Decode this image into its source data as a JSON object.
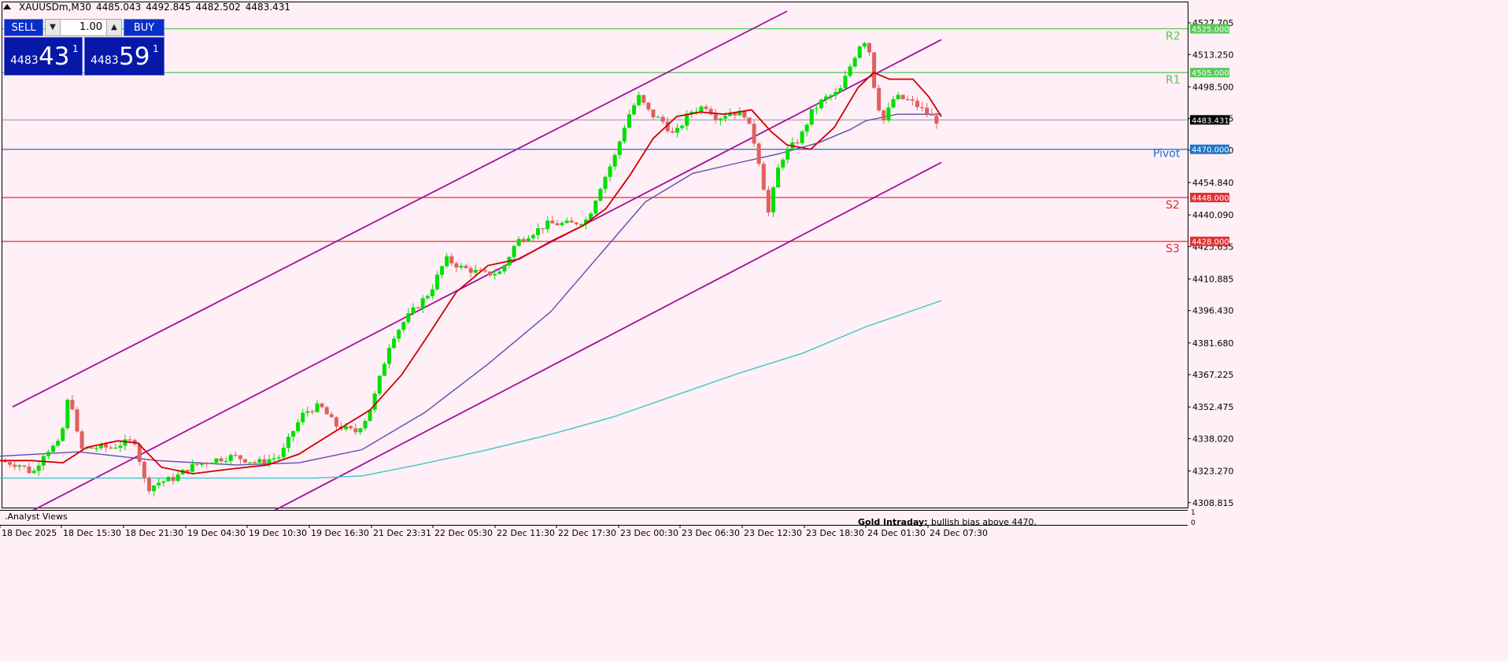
{
  "header": {
    "symbol": "XAUUSDm,M30",
    "open": "4485.043",
    "high": "4492.845",
    "low": "4482.502",
    "close": "4483.431"
  },
  "trade_panel": {
    "sell_label": "SELL",
    "buy_label": "BUY",
    "lot": "1.00",
    "bid_small": "4483",
    "bid_big": "43",
    "bid_sup": "1",
    "ask_small": "4483",
    "ask_big": "59",
    "ask_sup": "1"
  },
  "colors": {
    "background": "#ffeff6",
    "bull": "#00e000",
    "bear": "#e06060",
    "ma_fast": "#cc0000",
    "ma_mid": "#5b4fa8",
    "ma_slow": "#3cc8c8",
    "channel": "#a0119c",
    "resistance": "#56c856",
    "pivot": "#1e73c8",
    "support": "#e03030"
  },
  "chart_data": {
    "type": "candlestick",
    "symbol": "XAUUSDm",
    "timeframe": "M30",
    "y_ticks": [
      "4527.705",
      "4513.250",
      "4498.500",
      "4484.045",
      "4469.590",
      "4454.840",
      "4440.090",
      "4425.635",
      "4410.885",
      "4396.430",
      "4381.680",
      "4367.225",
      "4352.475",
      "4338.020",
      "4323.270",
      "4308.815"
    ],
    "x_labels": [
      "18 Dec 2025",
      "18 Dec 15:30",
      "18 Dec 21:30",
      "19 Dec 04:30",
      "19 Dec 10:30",
      "19 Dec 16:30",
      "21 Dec 23:31",
      "22 Dec 05:30",
      "22 Dec 11:30",
      "22 Dec 17:30",
      "23 Dec 00:30",
      "23 Dec 06:30",
      "23 Dec 12:30",
      "23 Dec 18:30",
      "24 Dec 01:30",
      "24 Dec 07:30"
    ],
    "ylim": [
      4304,
      4533
    ],
    "current_price": "4483.431",
    "levels": [
      {
        "name": "R2",
        "price": 4525.0,
        "label": "4525.000",
        "kind": "resistance"
      },
      {
        "name": "R1",
        "price": 4505.0,
        "label": "4505.000",
        "kind": "resistance"
      },
      {
        "name": "Pivot",
        "price": 4470.0,
        "label": "4470.000",
        "kind": "pivot"
      },
      {
        "name": "S2",
        "price": 4448.0,
        "label": "4448.000",
        "kind": "support"
      },
      {
        "name": "S3",
        "price": 4428.0,
        "label": "4428.000",
        "kind": "support"
      }
    ],
    "channel_lines": [
      {
        "x1": 16,
        "y1": 4352.5,
        "x2": 1000,
        "y2": 4533
      },
      {
        "x1": 35,
        "y1": 4304,
        "x2": 1196,
        "y2": 4520
      },
      {
        "x1": 342,
        "y1": 4304,
        "x2": 1196,
        "y2": 4464
      }
    ],
    "waypoints": [
      [
        0,
        4328
      ],
      [
        30,
        4326
      ],
      [
        45,
        4322
      ],
      [
        60,
        4332
      ],
      [
        80,
        4336
      ],
      [
        92,
        4360
      ],
      [
        105,
        4333
      ],
      [
        125,
        4334
      ],
      [
        145,
        4334
      ],
      [
        160,
        4336
      ],
      [
        175,
        4337
      ],
      [
        190,
        4315
      ],
      [
        205,
        4318
      ],
      [
        225,
        4320
      ],
      [
        245,
        4325
      ],
      [
        270,
        4328
      ],
      [
        300,
        4330
      ],
      [
        330,
        4327
      ],
      [
        360,
        4330
      ],
      [
        375,
        4341
      ],
      [
        390,
        4350
      ],
      [
        410,
        4353
      ],
      [
        430,
        4344
      ],
      [
        455,
        4341
      ],
      [
        470,
        4348
      ],
      [
        480,
        4358
      ],
      [
        500,
        4383
      ],
      [
        520,
        4393
      ],
      [
        550,
        4405
      ],
      [
        570,
        4420
      ],
      [
        590,
        4416
      ],
      [
        620,
        4413
      ],
      [
        640,
        4414
      ],
      [
        660,
        4428
      ],
      [
        680,
        4432
      ],
      [
        700,
        4436
      ],
      [
        730,
        4436
      ],
      [
        750,
        4438
      ],
      [
        765,
        4452
      ],
      [
        785,
        4467
      ],
      [
        800,
        4484
      ],
      [
        815,
        4494
      ],
      [
        830,
        4486
      ],
      [
        845,
        4483
      ],
      [
        860,
        4476
      ],
      [
        880,
        4487
      ],
      [
        900,
        4490
      ],
      [
        915,
        4484
      ],
      [
        930,
        4487
      ],
      [
        950,
        4486
      ],
      [
        965,
        4470
      ],
      [
        980,
        4441
      ],
      [
        992,
        4461
      ],
      [
        1000,
        4468
      ],
      [
        1020,
        4475
      ],
      [
        1035,
        4487
      ],
      [
        1050,
        4493
      ],
      [
        1070,
        4496
      ],
      [
        1085,
        4509
      ],
      [
        1100,
        4521
      ],
      [
        1108,
        4515
      ],
      [
        1115,
        4497
      ],
      [
        1125,
        4482
      ],
      [
        1140,
        4494
      ],
      [
        1160,
        4492
      ],
      [
        1180,
        4487
      ],
      [
        1193,
        4483
      ]
    ],
    "ma_fast": [
      [
        0,
        4328
      ],
      [
        40,
        4328
      ],
      [
        80,
        4327
      ],
      [
        110,
        4334
      ],
      [
        150,
        4337
      ],
      [
        175,
        4336
      ],
      [
        205,
        4325
      ],
      [
        245,
        4322
      ],
      [
        290,
        4324
      ],
      [
        340,
        4326
      ],
      [
        380,
        4331
      ],
      [
        420,
        4340
      ],
      [
        470,
        4351
      ],
      [
        510,
        4367
      ],
      [
        540,
        4383
      ],
      [
        580,
        4405
      ],
      [
        620,
        4417
      ],
      [
        660,
        4420
      ],
      [
        700,
        4428
      ],
      [
        740,
        4435
      ],
      [
        770,
        4443
      ],
      [
        800,
        4458
      ],
      [
        830,
        4475
      ],
      [
        860,
        4485
      ],
      [
        890,
        4487
      ],
      [
        920,
        4486
      ],
      [
        955,
        4488
      ],
      [
        980,
        4478
      ],
      [
        1000,
        4472
      ],
      [
        1030,
        4470
      ],
      [
        1060,
        4480
      ],
      [
        1090,
        4498
      ],
      [
        1110,
        4505
      ],
      [
        1130,
        4502
      ],
      [
        1160,
        4502
      ],
      [
        1180,
        4494
      ],
      [
        1196,
        4485
      ]
    ],
    "ma_mid": [
      [
        0,
        4330
      ],
      [
        100,
        4332
      ],
      [
        200,
        4328
      ],
      [
        300,
        4326
      ],
      [
        380,
        4327
      ],
      [
        460,
        4333
      ],
      [
        540,
        4350
      ],
      [
        620,
        4372
      ],
      [
        700,
        4396
      ],
      [
        760,
        4421
      ],
      [
        820,
        4446
      ],
      [
        880,
        4459
      ],
      [
        940,
        4464
      ],
      [
        990,
        4468
      ],
      [
        1040,
        4473
      ],
      [
        1080,
        4479
      ],
      [
        1100,
        4483
      ],
      [
        1140,
        4486
      ],
      [
        1196,
        4486
      ]
    ],
    "ma_slow": [
      [
        0,
        4320
      ],
      [
        200,
        4320
      ],
      [
        300,
        4320
      ],
      [
        400,
        4320
      ],
      [
        460,
        4321
      ],
      [
        530,
        4326
      ],
      [
        620,
        4333
      ],
      [
        700,
        4340
      ],
      [
        780,
        4348
      ],
      [
        860,
        4358
      ],
      [
        940,
        4368
      ],
      [
        1020,
        4377
      ],
      [
        1100,
        4389
      ],
      [
        1196,
        4401
      ]
    ]
  },
  "footer": {
    "analyst": ".Analyst Views",
    "gold_label": "Gold Intraday:",
    "gold_text": "bullish bias above 4470.",
    "sub_one": "1",
    "sub_zero": "0"
  }
}
